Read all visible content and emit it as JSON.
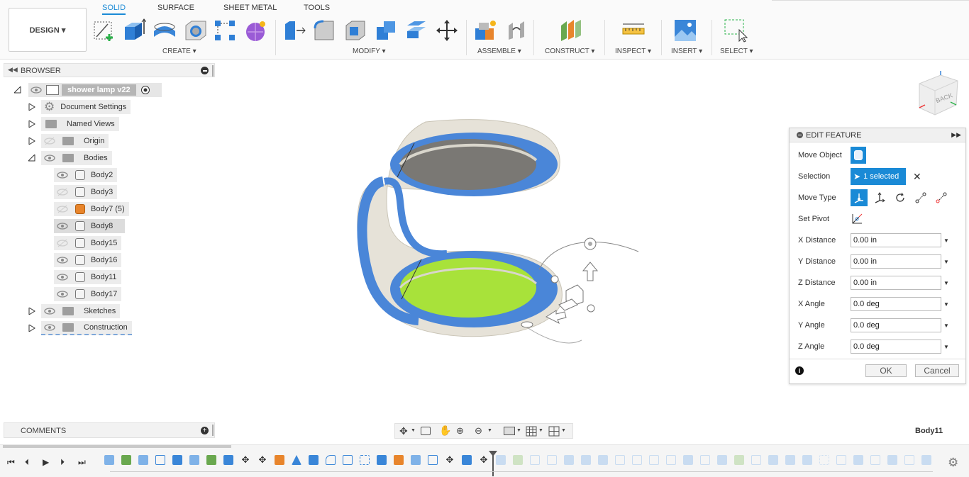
{
  "toolbar": {
    "design_label": "DESIGN ▾",
    "tabs": [
      {
        "label": "SOLID",
        "active": true
      },
      {
        "label": "SURFACE",
        "active": false
      },
      {
        "label": "SHEET METAL",
        "active": false
      },
      {
        "label": "TOOLS",
        "active": false
      }
    ],
    "groups": {
      "create": "CREATE ▾",
      "modify": "MODIFY ▾",
      "assemble": "ASSEMBLE ▾",
      "construct": "CONSTRUCT ▾",
      "inspect": "INSPECT ▾",
      "insert": "INSERT ▾",
      "select": "SELECT ▾"
    }
  },
  "browser": {
    "title": "BROWSER",
    "root": "shower lamp v22",
    "items": [
      {
        "label": "Document Settings"
      },
      {
        "label": "Named Views"
      },
      {
        "label": "Origin"
      },
      {
        "label": "Bodies"
      },
      {
        "label": "Sketches"
      },
      {
        "label": "Construction"
      }
    ],
    "bodies": [
      {
        "label": "Body2"
      },
      {
        "label": "Body3"
      },
      {
        "label": "Body7 (5)"
      },
      {
        "label": "Body8"
      },
      {
        "label": "Body15"
      },
      {
        "label": "Body16"
      },
      {
        "label": "Body11"
      },
      {
        "label": "Body17"
      }
    ]
  },
  "comments": {
    "title": "COMMENTS"
  },
  "view_cube": {
    "face_label": "BACK"
  },
  "edit_feature": {
    "title": "EDIT FEATURE",
    "move_object_label": "Move Object",
    "selection_label": "Selection",
    "selection_value": "1 selected",
    "move_type_label": "Move Type",
    "set_pivot_label": "Set Pivot",
    "fields": [
      {
        "label": "X Distance",
        "value": "0.00 in"
      },
      {
        "label": "Y Distance",
        "value": "0.00 in"
      },
      {
        "label": "Z Distance",
        "value": "0.00 in"
      },
      {
        "label": "X Angle",
        "value": "0.0 deg"
      },
      {
        "label": "Y Angle",
        "value": "0.0 deg"
      },
      {
        "label": "Z Angle",
        "value": "0.0 deg"
      }
    ],
    "ok_label": "OK",
    "cancel_label": "Cancel"
  },
  "status": {
    "selected_body": "Body11"
  },
  "colors": {
    "accent": "#1a8ad6",
    "body_blue": "#4a86d8",
    "body_green": "#a8e23a",
    "body_orange": "#e8852c",
    "dark_gray": "#7a7874"
  }
}
